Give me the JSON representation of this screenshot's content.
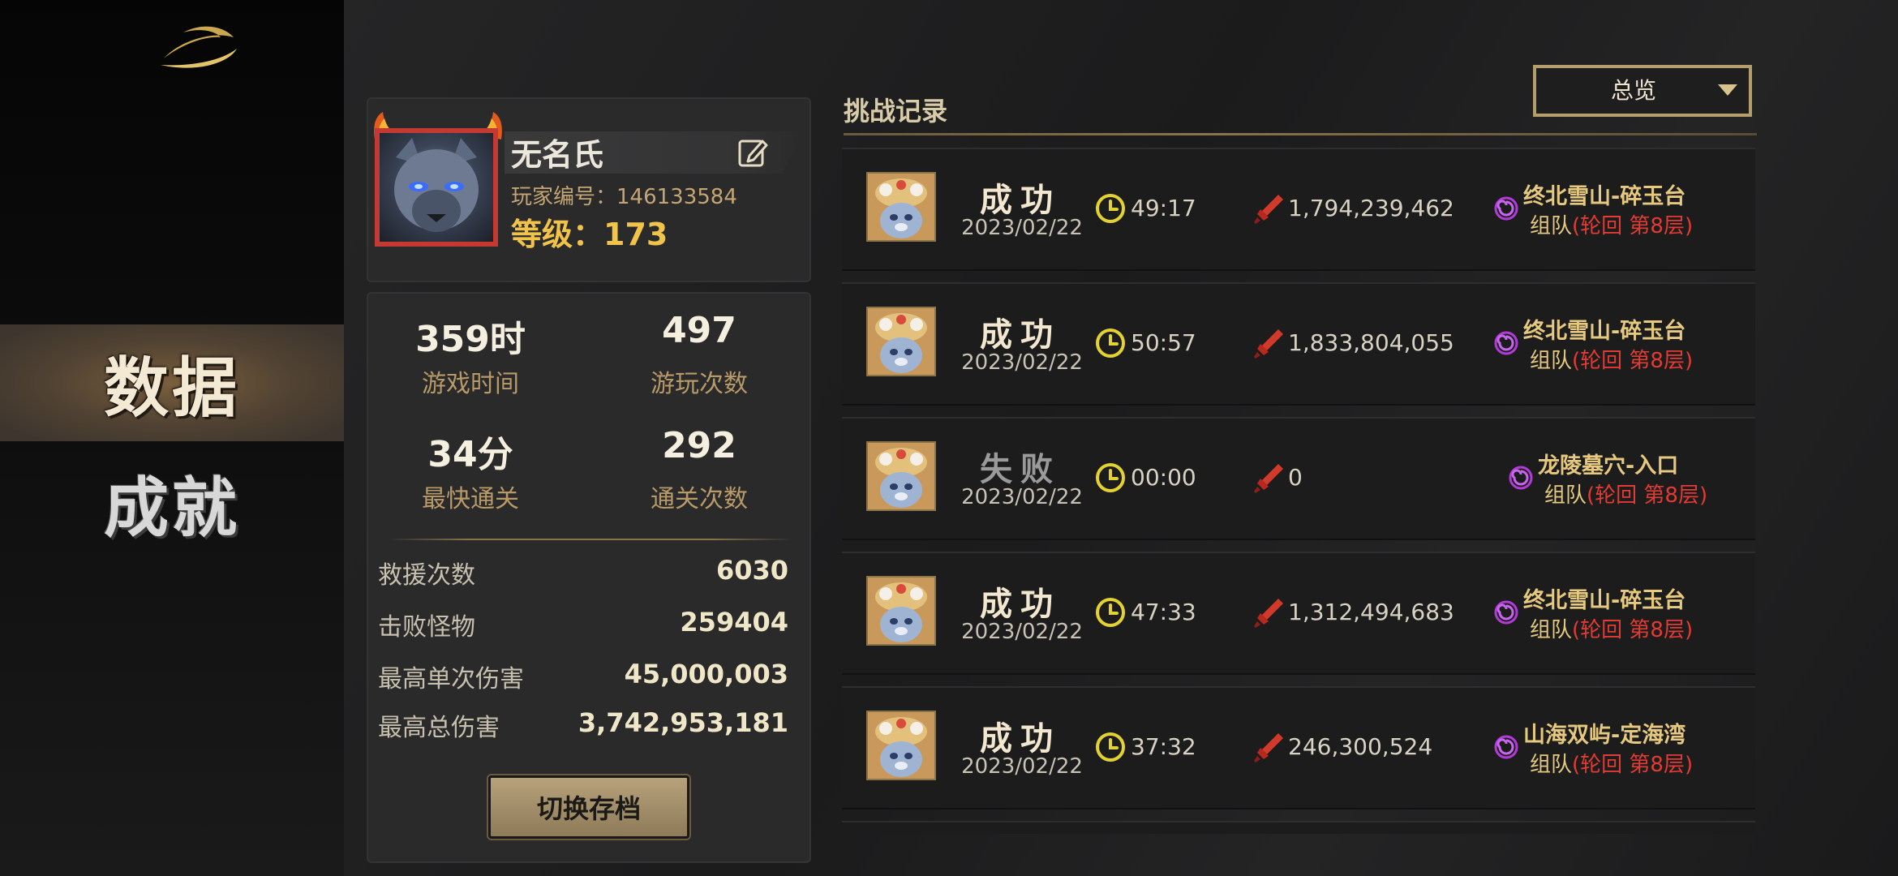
{
  "sidebar": {
    "logo_icon": "gold-swoosh-logo",
    "nav": [
      {
        "label": "数据",
        "active": true
      },
      {
        "label": "成就",
        "active": false
      }
    ]
  },
  "profile": {
    "name": "无名氏",
    "id_label": "玩家编号：",
    "id_value": "146133584",
    "level_label": "等级：",
    "level_value": "173",
    "edit_icon": "edit-icon"
  },
  "stats": {
    "grid": [
      {
        "value": "359时",
        "label": "游戏时间"
      },
      {
        "value": "497",
        "label": "游玩次数"
      },
      {
        "value": "34分",
        "label": "最快通关"
      },
      {
        "value": "292",
        "label": "通关次数"
      }
    ],
    "rows": [
      {
        "label": "救援次数",
        "value": "6030"
      },
      {
        "label": "击败怪物",
        "value": "259404"
      },
      {
        "label": "最高单次伤害",
        "value": "45,000,003"
      },
      {
        "label": "最高总伤害",
        "value": "3,742,953,181"
      }
    ],
    "switch_button": "切换存档"
  },
  "records": {
    "title": "挑战记录",
    "filter": "总览",
    "items": [
      {
        "result": "成功",
        "date": "2023/02/22",
        "time": "49:17",
        "damage": "1,794,239,462",
        "stage": "终北雪山-碎玉台",
        "mode_prefix": "组队",
        "mode_detail": "(轮回  第8层)",
        "success": true
      },
      {
        "result": "成功",
        "date": "2023/02/22",
        "time": "50:57",
        "damage": "1,833,804,055",
        "stage": "终北雪山-碎玉台",
        "mode_prefix": "组队",
        "mode_detail": "(轮回  第8层)",
        "success": true
      },
      {
        "result": "失败",
        "date": "2023/02/22",
        "time": "00:00",
        "damage": "0",
        "stage": "龙陵墓穴-入口",
        "mode_prefix": "组队",
        "mode_detail": "(轮回  第8层)",
        "success": false
      },
      {
        "result": "成功",
        "date": "2023/02/22",
        "time": "47:33",
        "damage": "1,312,494,683",
        "stage": "终北雪山-碎玉台",
        "mode_prefix": "组队",
        "mode_detail": "(轮回  第8层)",
        "success": true
      },
      {
        "result": "成功",
        "date": "2023/02/22",
        "time": "37:32",
        "damage": "246,300,524",
        "stage": "山海双屿-定海湾",
        "mode_prefix": "组队",
        "mode_detail": "(轮回  第8层)",
        "success": true
      }
    ]
  },
  "colors": {
    "gold": "#f2c34a",
    "accent_brown": "#8a7449",
    "danger_red": "#e23b33",
    "purple_swirl": "#b23bd8"
  }
}
